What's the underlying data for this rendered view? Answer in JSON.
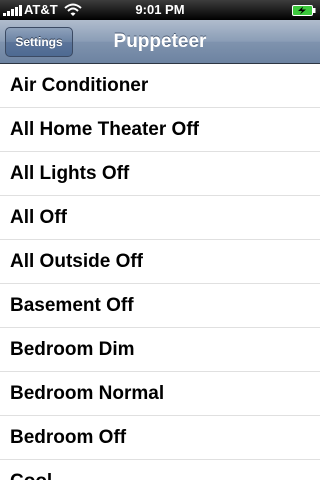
{
  "status_bar": {
    "carrier": "AT&T",
    "time": "9:01 PM"
  },
  "nav": {
    "back_label": "Settings",
    "title": "Puppeteer"
  },
  "list": {
    "items": [
      {
        "label": "Air Conditioner"
      },
      {
        "label": "All Home Theater Off"
      },
      {
        "label": "All Lights Off"
      },
      {
        "label": "All Off"
      },
      {
        "label": "All Outside Off"
      },
      {
        "label": "Basement Off"
      },
      {
        "label": "Bedroom Dim"
      },
      {
        "label": "Bedroom Normal"
      },
      {
        "label": "Bedroom Off"
      },
      {
        "label": "Cool"
      }
    ]
  },
  "colors": {
    "nav_bar": "#7f93ae",
    "status_bar": "#000000",
    "battery_charge": "#3cc83c"
  },
  "icons": [
    "signal-bars-icon",
    "wifi-icon",
    "battery-charging-icon"
  ]
}
